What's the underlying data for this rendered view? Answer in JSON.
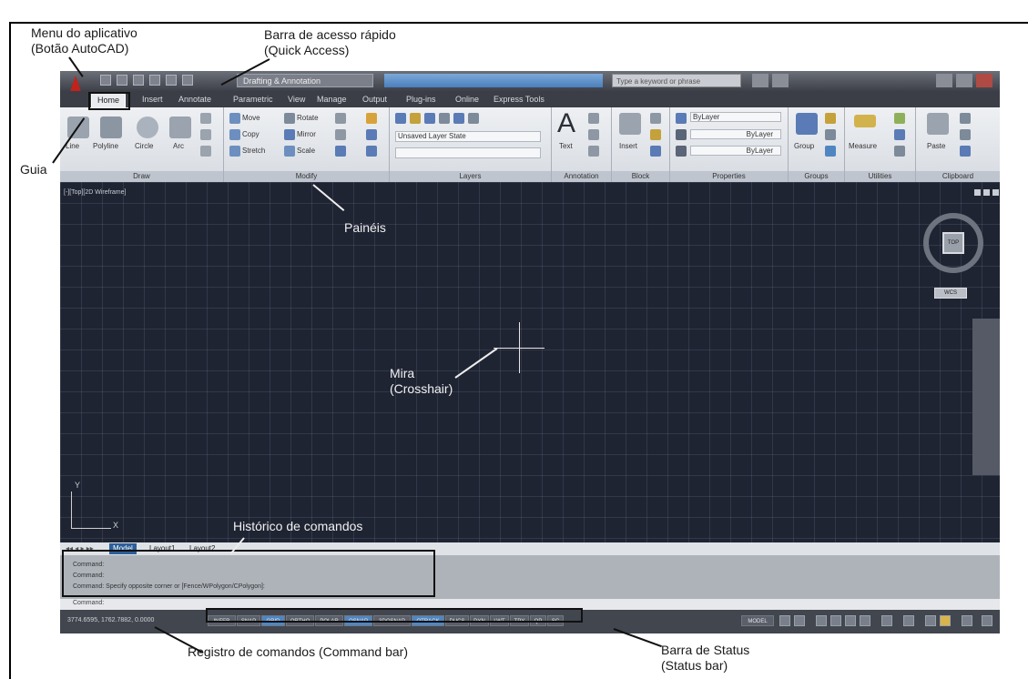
{
  "annotations": {
    "app_menu": "Menu do aplicativo",
    "app_menu_sub": "(Botão AutoCAD)",
    "quick_access": "Barra de acesso rápido",
    "quick_access_sub": "(Quick Access)",
    "tab_guide": "Guia",
    "panels": "Painéis",
    "crosshair": "Mira",
    "crosshair_sub": "(Crosshair)",
    "command_history": "Histórico de comandos",
    "command_bar": "Registro de comandos (Command bar)",
    "status_bar": "Barra de Status",
    "status_bar_sub": "(Status bar)"
  },
  "titlebar": {
    "workspace": "Drafting & Annotation",
    "search_placeholder": "Type a keyword or phrase"
  },
  "tabs": [
    "Home",
    "Insert",
    "Annotate",
    "Parametric",
    "View",
    "Manage",
    "Output",
    "Plug-ins",
    "Online",
    "Express Tools"
  ],
  "ribbon": {
    "draw": {
      "title": "Draw",
      "line": "Line",
      "polyline": "Polyline",
      "circle": "Circle",
      "arc": "Arc"
    },
    "modify": {
      "title": "Modify",
      "move": "Move",
      "rotate": "Rotate",
      "copy": "Copy",
      "mirror": "Mirror",
      "stretch": "Stretch",
      "scale": "Scale"
    },
    "layers": {
      "title": "Layers",
      "state": "Unsaved Layer State"
    },
    "annotation": {
      "title": "Annotation",
      "text": "Text"
    },
    "block": {
      "title": "Block",
      "insert": "Insert"
    },
    "properties": {
      "title": "Properties",
      "bylayer": "ByLayer"
    },
    "groups": {
      "title": "Groups",
      "group": "Group"
    },
    "utilities": {
      "title": "Utilities",
      "measure": "Measure"
    },
    "clipboard": {
      "title": "Clipboard",
      "paste": "Paste"
    }
  },
  "viewport": {
    "label": "[-][Top][2D Wireframe]",
    "wcs": "WCS",
    "ucs_x": "X",
    "ucs_y": "Y",
    "top": "TOP"
  },
  "layout_tabs": [
    "Model",
    "Layout1",
    "Layout2"
  ],
  "command_history": [
    "Command:",
    "Command:",
    "Command: Specify opposite corner or [Fence/WPolygon/CPolygon]:"
  ],
  "command_prompt": "Command:",
  "status": {
    "coords": "3774.6595, 1762.7882, 0.0000",
    "buttons": [
      {
        "label": "INFER",
        "on": false
      },
      {
        "label": "SNAP",
        "on": false
      },
      {
        "label": "GRID",
        "on": true
      },
      {
        "label": "ORTHO",
        "on": false
      },
      {
        "label": "POLAR",
        "on": false
      },
      {
        "label": "OSNAP",
        "on": true
      },
      {
        "label": "3DOSNAP",
        "on": false
      },
      {
        "label": "OTRACK",
        "on": true
      },
      {
        "label": "DUCS",
        "on": false
      },
      {
        "label": "DYN",
        "on": false
      },
      {
        "label": "LWT",
        "on": false
      },
      {
        "label": "TPY",
        "on": false
      },
      {
        "label": "QP",
        "on": false
      },
      {
        "label": "SC",
        "on": false
      }
    ],
    "model": "MODEL"
  },
  "colors": {
    "app_red": "#c3221c",
    "viewport_bg": "#1f2433",
    "status_on": "#4f86c2"
  }
}
